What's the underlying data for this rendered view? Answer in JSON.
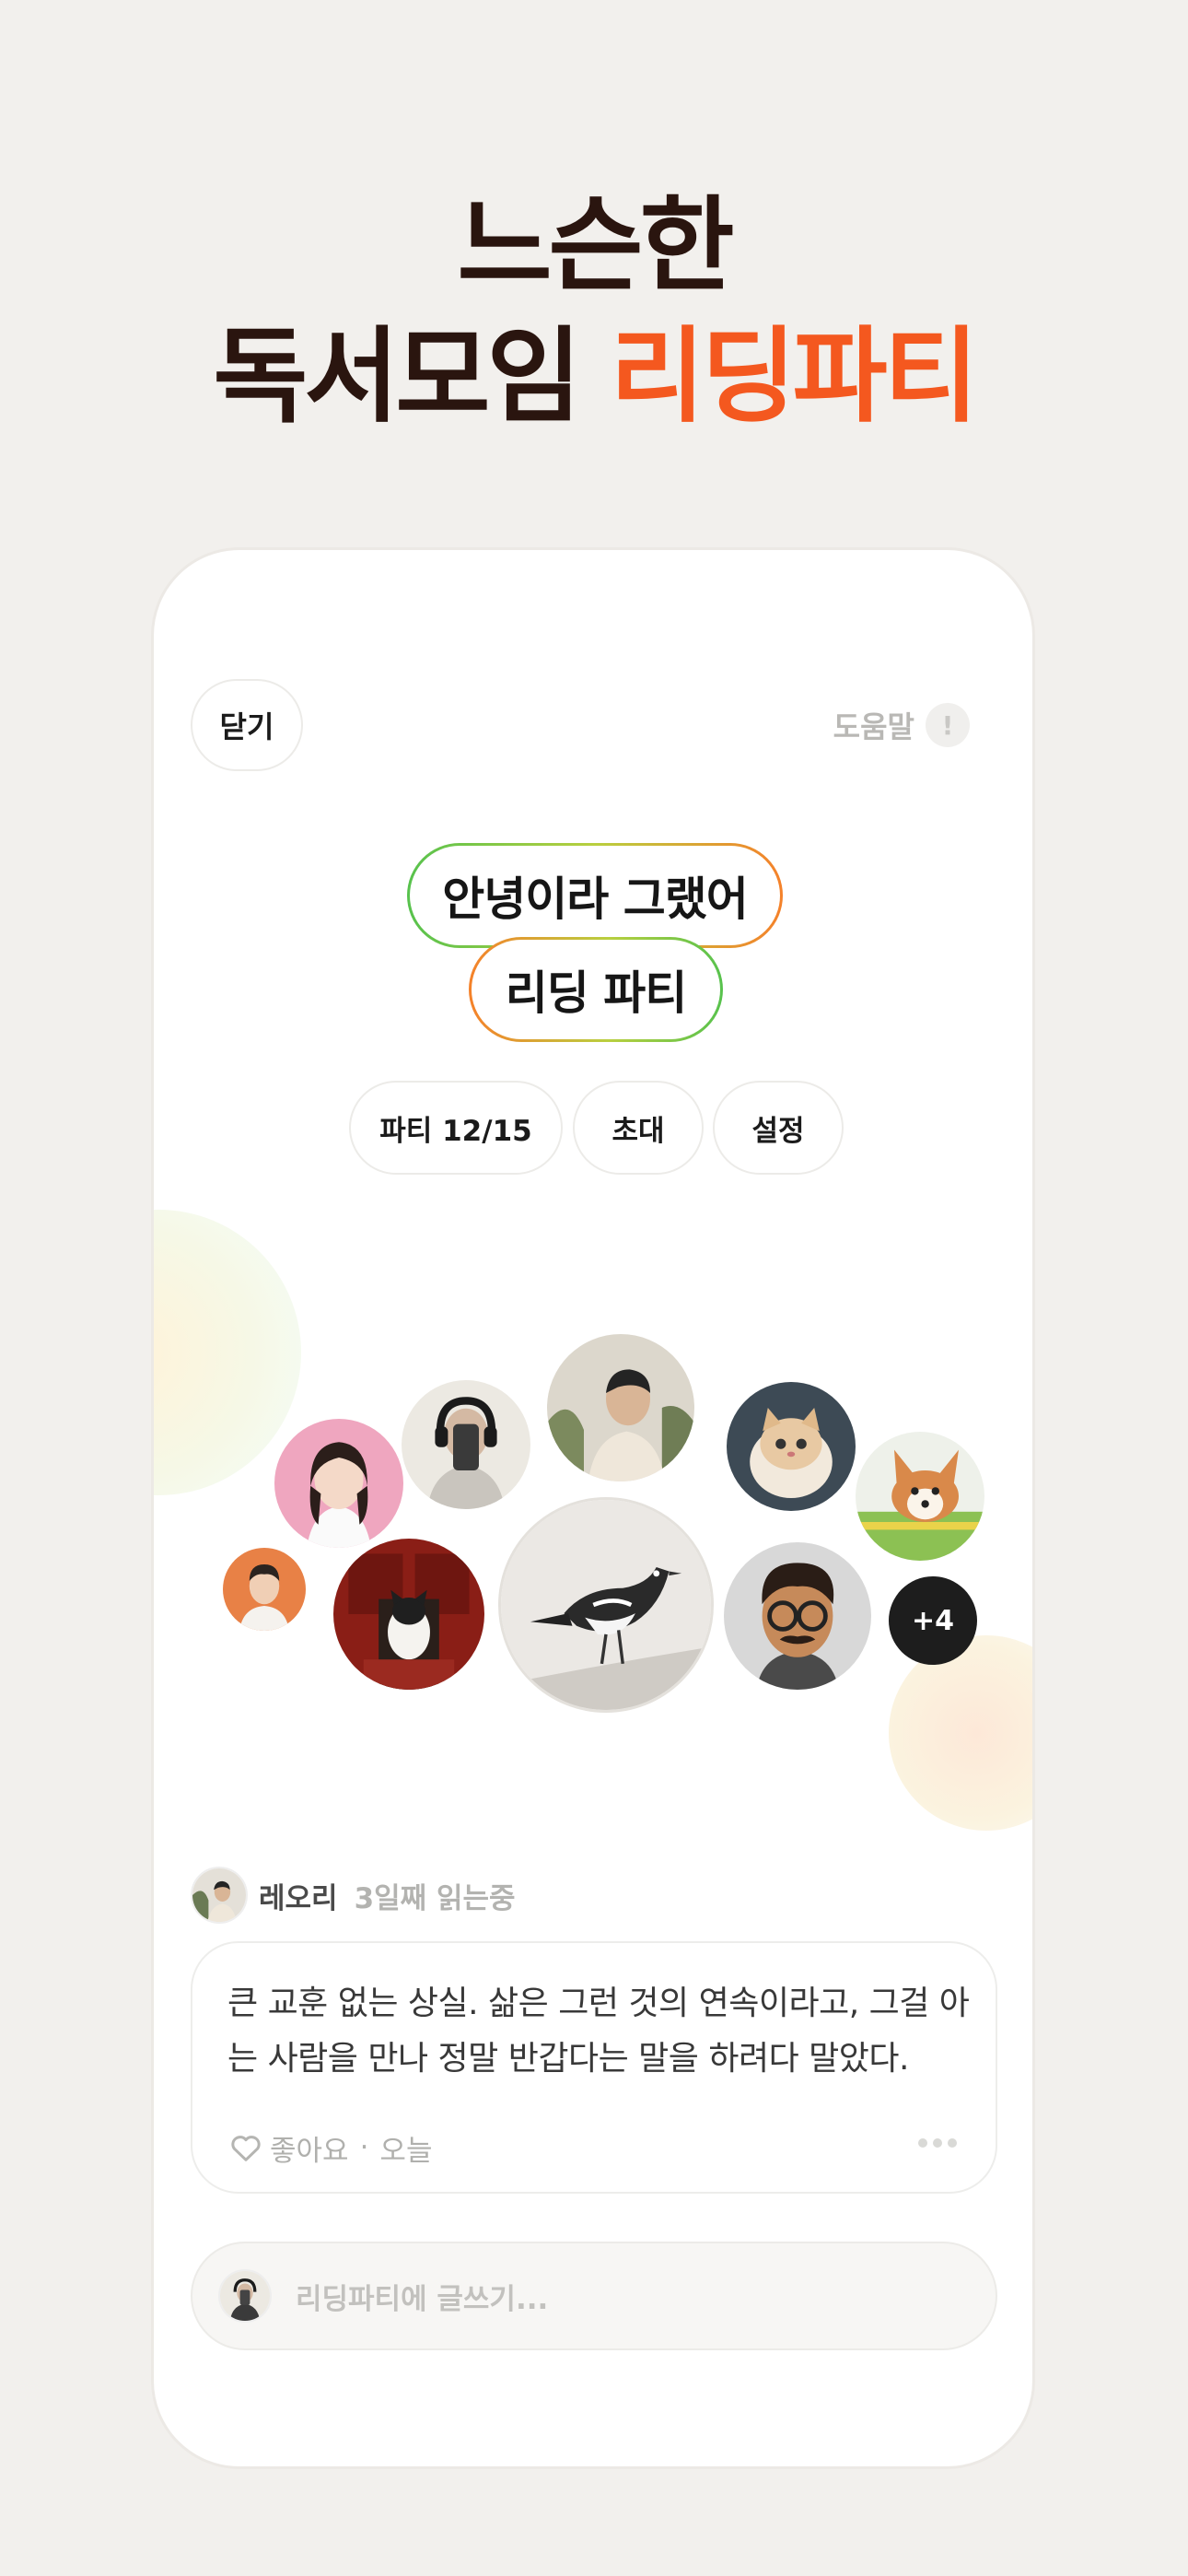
{
  "headline": {
    "line1": "느슨한",
    "line2_prefix": "독서모임 ",
    "line2_accent": "리딩파티"
  },
  "topbar": {
    "close_label": "닫기",
    "help_label": "도움말",
    "help_icon_glyph": "!"
  },
  "book": {
    "title": "안녕이라 그랬어",
    "subtitle": "리딩 파티"
  },
  "chips": {
    "party": "파티 12/15",
    "invite": "초대",
    "settings": "설정"
  },
  "members": {
    "more_count": "+4"
  },
  "post": {
    "author": "레오리",
    "status": "3일째 읽는중",
    "body": "큰 교훈 없는 상실. 삶은 그런 것의 연속이라고, 그걸 아는 사람을 만나 정말 반갑다는 말을 하려다 말았다.",
    "like_label": "좋아요",
    "separator": "·",
    "time": "오늘"
  },
  "composer": {
    "placeholder": "리딩파티에 글쓰기..."
  },
  "colors": {
    "accent": "#f4581f",
    "headline": "#2a150f",
    "background": "#f2f0ed"
  }
}
